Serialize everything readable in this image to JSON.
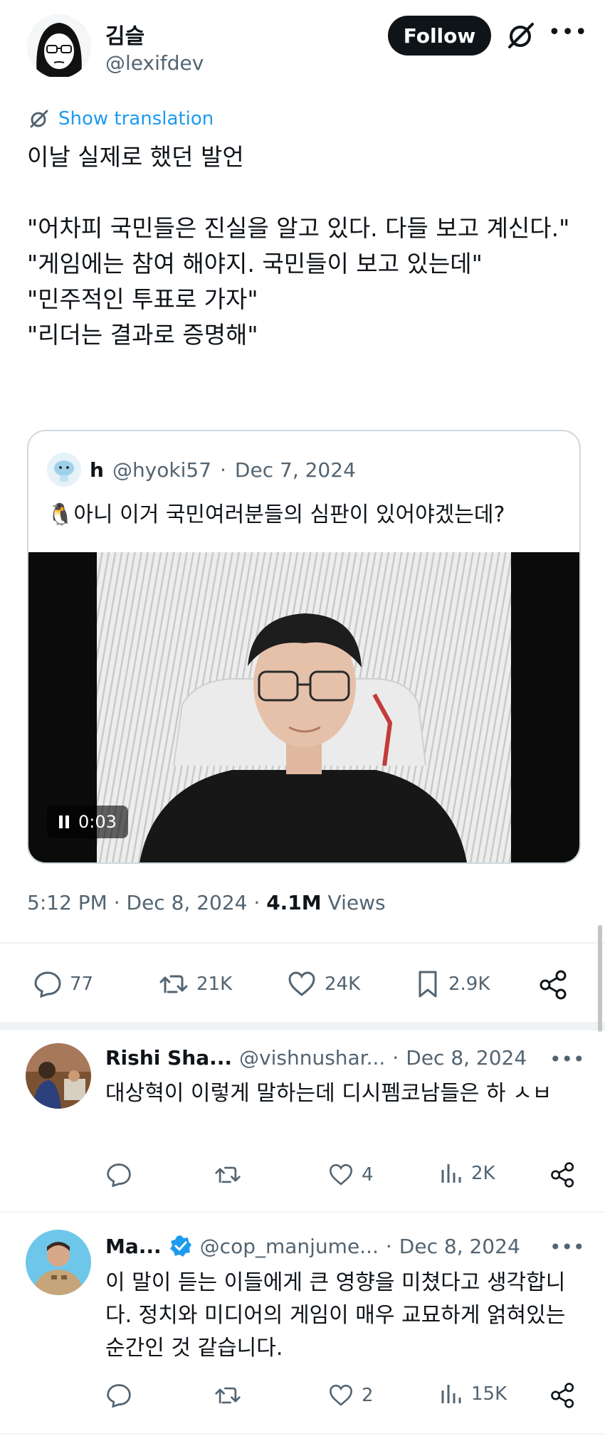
{
  "author": {
    "name": "김슬",
    "handle": "@lexifdev",
    "follow_label": "Follow"
  },
  "translate_label": "Show translation",
  "tweet_text": "이날 실제로 했던 발언\n\n\"어차피 국민들은 진실을 알고 있다. 다들 보고 계신다.\"\n\"게임에는 참여 해야지. 국민들이 보고 있는데\"\n\"민주적인 투표로 가자\"\n\"리더는 결과로 증명해\"",
  "quoted": {
    "name": "h",
    "handle": "@hyoki57",
    "dot": "·",
    "date": "Dec 7, 2024",
    "text": "🐧아니 이거 국민여러분들의 심판이 있어야겠는데?",
    "video_time": "0:03"
  },
  "meta": {
    "time_date": "5:12 PM · Dec 8, 2024 · ",
    "views_count": "4.1M",
    "views_label": " Views"
  },
  "stats": {
    "replies": "77",
    "reposts": "21K",
    "likes": "24K",
    "bookmarks": "2.9K"
  },
  "replies": [
    {
      "name": "Rishi Sha...",
      "handle": "@vishnushar...",
      "dot": "·",
      "date": "Dec 8, 2024",
      "text": "대상혁이 이렇게 말하는데 디시펨코남들은 하 ㅅㅂ",
      "replies": "",
      "reposts": "",
      "likes": "4",
      "views": "2K"
    },
    {
      "name": "Ma...",
      "handle": "@cop_manjume...",
      "dot": "·",
      "date": "Dec 8, 2024",
      "text": "이 말이 듣는 이들에게 큰 영향을 미쳤다고 생각합니다. 정치와 미디어의 게임이 매우 교묘하게 얽혀있는 순간인 것 같습니다.",
      "replies": "",
      "reposts": "",
      "likes": "2",
      "views": "15K"
    }
  ],
  "colors": {
    "accent": "#1d9bf0",
    "text": "#0f1419",
    "muted": "#536471",
    "border": "#cfd9de"
  }
}
